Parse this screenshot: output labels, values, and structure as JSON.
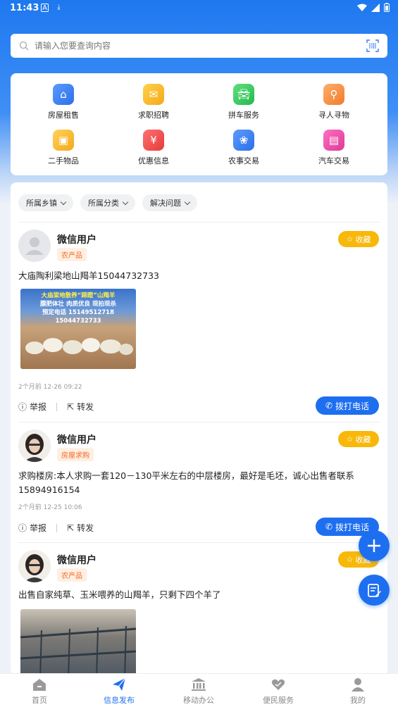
{
  "status": {
    "time": "11:43",
    "icons": [
      "notification-a-icon",
      "download-icon",
      "wifi-icon",
      "signal-icon",
      "battery-icon"
    ]
  },
  "search": {
    "placeholder": "请输入您要查询内容"
  },
  "categories": [
    {
      "label": "房屋租售",
      "icon": "house-icon",
      "color": "#3b7bf0"
    },
    {
      "label": "求职招聘",
      "icon": "bag-icon",
      "color": "#f6b020"
    },
    {
      "label": "拼车服务",
      "icon": "car-icon",
      "color": "#2ec65a"
    },
    {
      "label": "寻人寻物",
      "icon": "search-person-icon",
      "color": "#f5893a"
    },
    {
      "label": "二手物品",
      "icon": "box-icon",
      "color": "#f4b528"
    },
    {
      "label": "优惠信息",
      "icon": "coupon-icon",
      "color": "#ef4b4b"
    },
    {
      "label": "农事交易",
      "icon": "farm-icon",
      "color": "#3b7bf0"
    },
    {
      "label": "汽车交易",
      "icon": "bus-icon",
      "color": "#e84aa5"
    }
  ],
  "filters": [
    "所属乡镇",
    "所属分类",
    "解决问题"
  ],
  "posts": [
    {
      "user": "微信用户",
      "tag": "农产品",
      "fav": "收藏",
      "text": "大庙陶利梁地山羯羊15044732733",
      "time": "2个月前 12-26 09:22",
      "report": "举报",
      "share": "转发",
      "call": "拨打电话",
      "image_text": [
        "大庙梁地散养“蹄蹬”山羯羊",
        "膘肥体壮  肉质优良  现拍现杀",
        "预定电话 15149512718",
        "15044732733"
      ]
    },
    {
      "user": "微信用户",
      "tag": "房屋求购",
      "fav": "收藏",
      "text": "求购楼房:本人求购一套120－130平米左右的中层楼房，最好是毛坯，诚心出售者联系15894916154",
      "time": "2个月前 12-25 10:06",
      "report": "举报",
      "share": "转发",
      "call": "拨打电话"
    },
    {
      "user": "微信用户",
      "tag": "农产品",
      "fav": "收藏",
      "text": "出售自家纯草、玉米喂养的山羯羊，只剩下四个羊了"
    }
  ],
  "tabs": [
    {
      "label": "首页",
      "icon": "home-icon"
    },
    {
      "label": "信息发布",
      "icon": "send-icon",
      "active": true
    },
    {
      "label": "移动办公",
      "icon": "bank-icon"
    },
    {
      "label": "便民服务",
      "icon": "heart-hand-icon"
    },
    {
      "label": "我的",
      "icon": "user-icon"
    }
  ],
  "colors": {
    "primary": "#1e6ff0",
    "fav": "#f8b80a",
    "tag_bg": "#ffeee2",
    "tag_text": "#f06a1d"
  }
}
